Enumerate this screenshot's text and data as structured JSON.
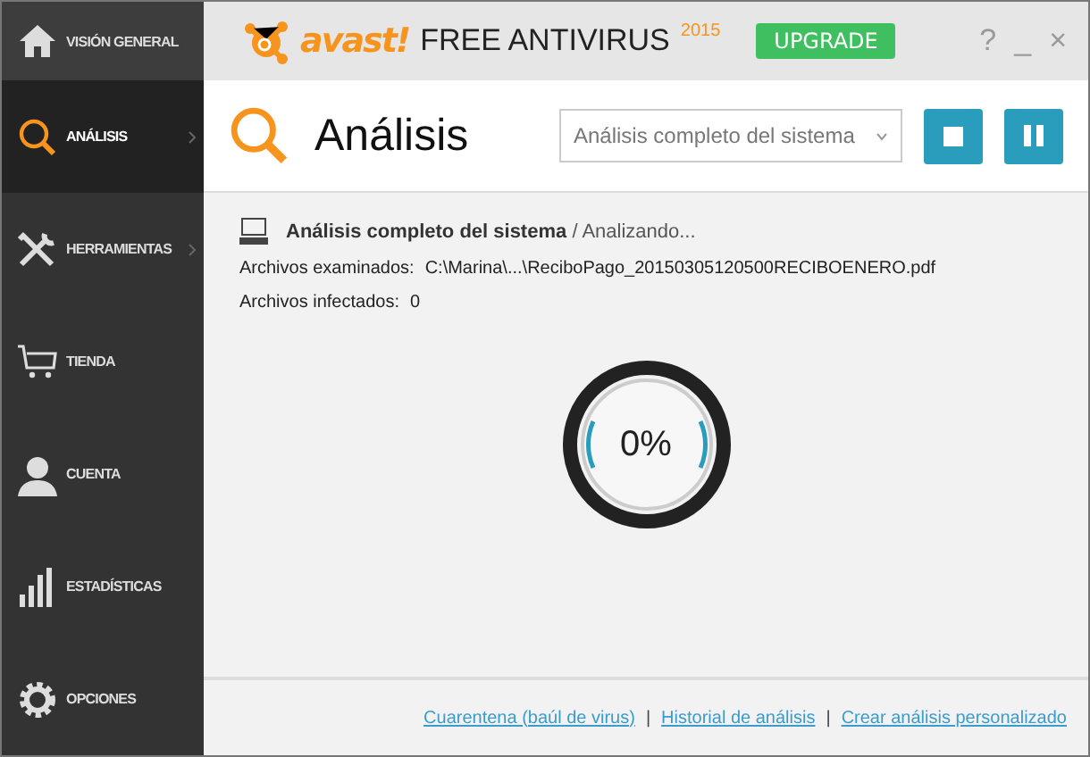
{
  "sidebar": {
    "items": [
      {
        "label": "VISIÓN GENERAL",
        "kind": "home",
        "selected": false,
        "submenu": false
      },
      {
        "label": "ANÁLISIS",
        "kind": "search",
        "selected": true,
        "submenu": true
      },
      {
        "label": "HERRAMIENTAS",
        "kind": "tools",
        "selected": false,
        "submenu": true
      },
      {
        "label": "TIENDA",
        "kind": "cart",
        "selected": false,
        "submenu": false
      },
      {
        "label": "CUENTA",
        "kind": "user",
        "selected": false,
        "submenu": false
      },
      {
        "label": "ESTADÍSTICAS",
        "kind": "stats",
        "selected": false,
        "submenu": false
      },
      {
        "label": "OPCIONES",
        "kind": "gear",
        "selected": false,
        "submenu": false
      }
    ]
  },
  "titlebar": {
    "brand": "avast!",
    "product": "FREE ANTIVIRUS",
    "year": "2015",
    "upgrade": "UPGRADE",
    "controls": [
      "?",
      "_",
      "×"
    ]
  },
  "header": {
    "title": "Análisis",
    "scan_select": "Análisis completo del sistema"
  },
  "scan": {
    "name": "Análisis completo del sistema",
    "status": "/ Analizando...",
    "examined_label": "Archivos examinados:",
    "examined_value": "C:\\Marina\\...\\ReciboPago_20150305120500RECIBOENERO.pdf",
    "infected_label": "Archivos infectados:",
    "infected_value": "0",
    "percent": "0%"
  },
  "footer": {
    "links": [
      "Cuarentena (baúl de virus)",
      "Historial de análisis",
      "Crear análisis personalizado"
    ],
    "separator": "|"
  }
}
